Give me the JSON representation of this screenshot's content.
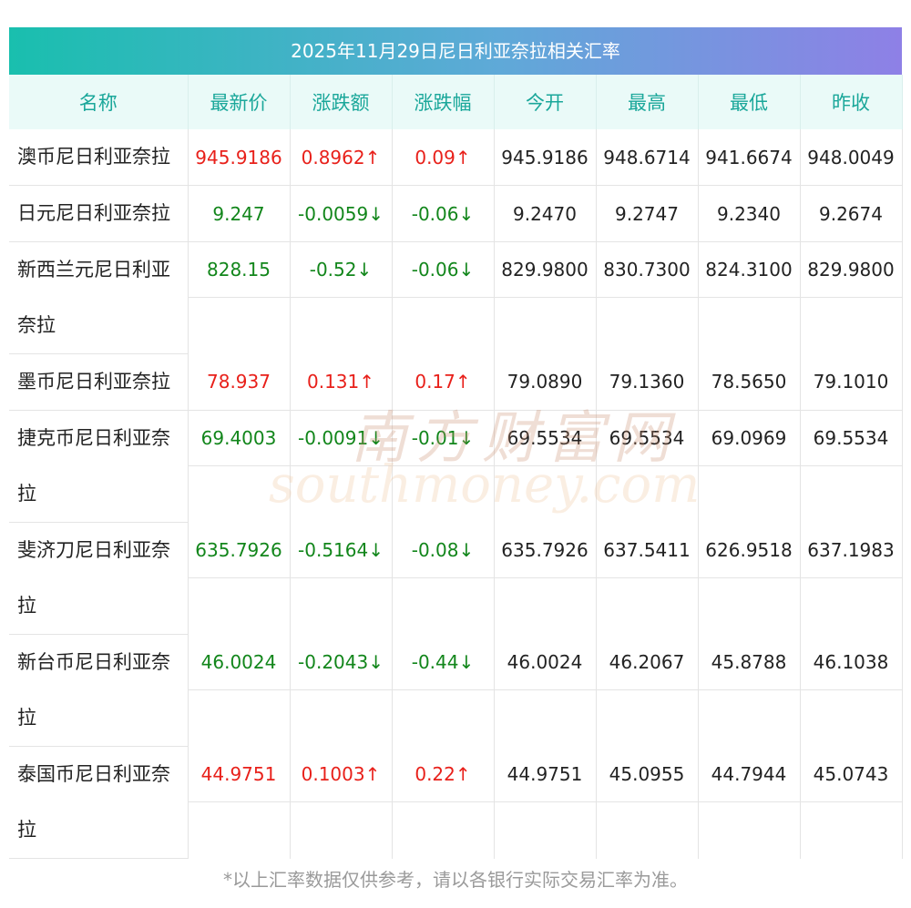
{
  "title": "2025年11月29日尼日利亚奈拉相关汇率",
  "headers": [
    "名称",
    "最新价",
    "涨跌额",
    "涨跌幅",
    "今开",
    "最高",
    "最低",
    "昨收"
  ],
  "rows": [
    {
      "name": "澳币尼日利亚奈拉",
      "latest": "945.9186",
      "change": "0.8962↑",
      "pct": "0.09↑",
      "open": "945.9186",
      "high": "948.6714",
      "low": "941.6674",
      "prev": "948.0049",
      "trend": "up"
    },
    {
      "name": "日元尼日利亚奈拉",
      "latest": "9.247",
      "change": "-0.0059↓",
      "pct": "-0.06↓",
      "open": "9.2470",
      "high": "9.2747",
      "low": "9.2340",
      "prev": "9.2674",
      "trend": "down"
    },
    {
      "name": "新西兰元尼日利亚奈拉",
      "latest": "828.15",
      "change": "-0.52↓",
      "pct": "-0.06↓",
      "open": "829.9800",
      "high": "830.7300",
      "low": "824.3100",
      "prev": "829.9800",
      "trend": "down"
    },
    {
      "name": "墨币尼日利亚奈拉",
      "latest": "78.937",
      "change": "0.131↑",
      "pct": "0.17↑",
      "open": "79.0890",
      "high": "79.1360",
      "low": "78.5650",
      "prev": "79.1010",
      "trend": "up"
    },
    {
      "name": "捷克币尼日利亚奈拉",
      "latest": "69.4003",
      "change": "-0.0091↓",
      "pct": "-0.01↓",
      "open": "69.5534",
      "high": "69.5534",
      "low": "69.0969",
      "prev": "69.5534",
      "trend": "down"
    },
    {
      "name": "斐济刀尼日利亚奈拉",
      "latest": "635.7926",
      "change": "-0.5164↓",
      "pct": "-0.08↓",
      "open": "635.7926",
      "high": "637.5411",
      "low": "626.9518",
      "prev": "637.1983",
      "trend": "down"
    },
    {
      "name": "新台币尼日利亚奈拉",
      "latest": "46.0024",
      "change": "-0.2043↓",
      "pct": "-0.44↓",
      "open": "46.0024",
      "high": "46.2067",
      "low": "45.8788",
      "prev": "46.1038",
      "trend": "down"
    },
    {
      "name": "泰国币尼日利亚奈拉",
      "latest": "44.9751",
      "change": "0.1003↑",
      "pct": "0.22↑",
      "open": "44.9751",
      "high": "45.0955",
      "low": "44.7944",
      "prev": "45.0743",
      "trend": "up"
    }
  ],
  "watermark": {
    "cn": "南方财富网",
    "en": "southmoney.com"
  },
  "footnote": "*以上汇率数据仅供参考，请以各银行实际交易汇率为准。",
  "colors": {
    "up": "#e8201a",
    "down": "#12861b",
    "header_text": "#1aa79a"
  }
}
